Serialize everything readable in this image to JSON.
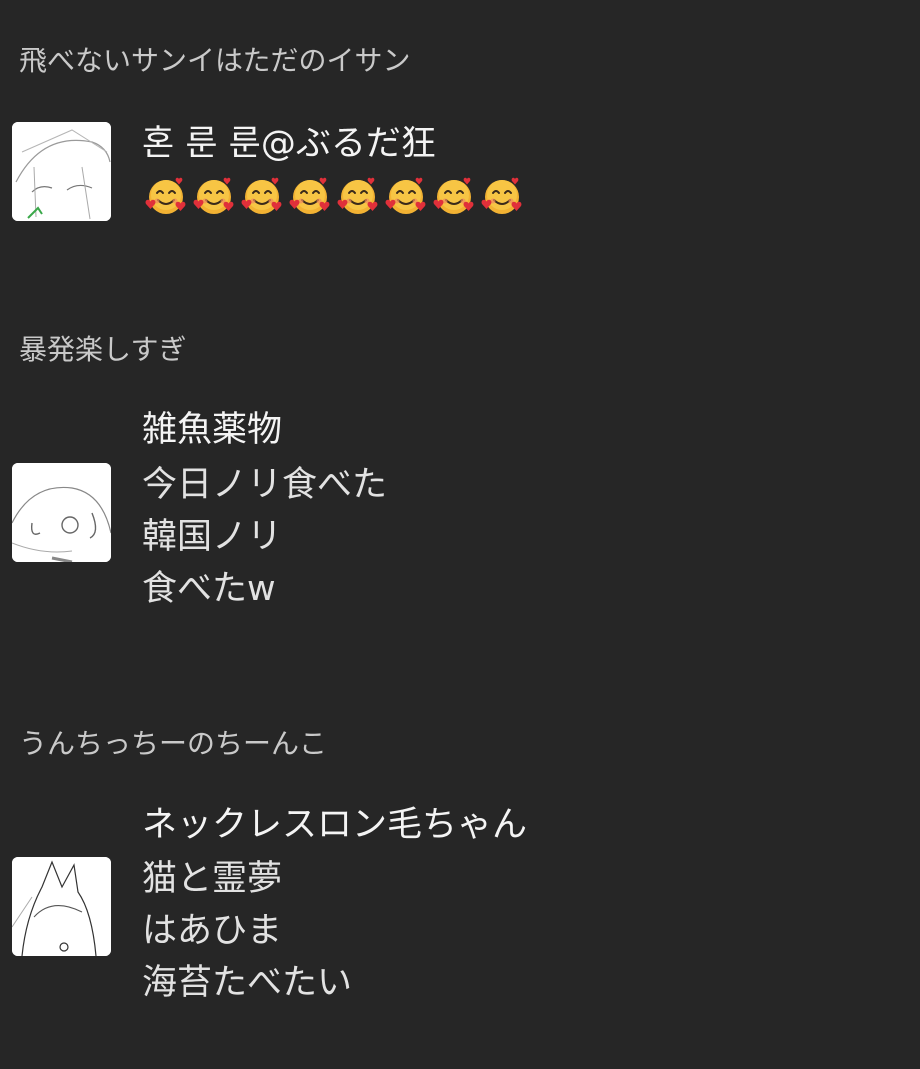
{
  "groups": [
    {
      "header": "飛べないサンイはただのイサン",
      "sender": "혼 룬 룬@ぶるだ狂",
      "avatar_icon": "sketch-avatar-icon",
      "emoji_name": "smiling-face-with-hearts-icon",
      "emoji_count": 8
    },
    {
      "header": "暴発楽しすぎ",
      "sender": "雑魚薬物",
      "avatar_icon": "sketch-avatar-icon",
      "lines": [
        "今日ノリ食べた",
        "韓国ノリ",
        "食べたw"
      ]
    },
    {
      "header": "うんちっちーのちーんこ",
      "sender": "ネックレスロン毛ちゃん",
      "avatar_icon": "sketch-avatar-icon",
      "lines": [
        "猫と霊夢",
        "はあひま",
        "海苔たべたい"
      ]
    }
  ],
  "colors": {
    "background": "#262626",
    "header_text": "#c9c9c9",
    "message_text": "#e2e2e2"
  }
}
